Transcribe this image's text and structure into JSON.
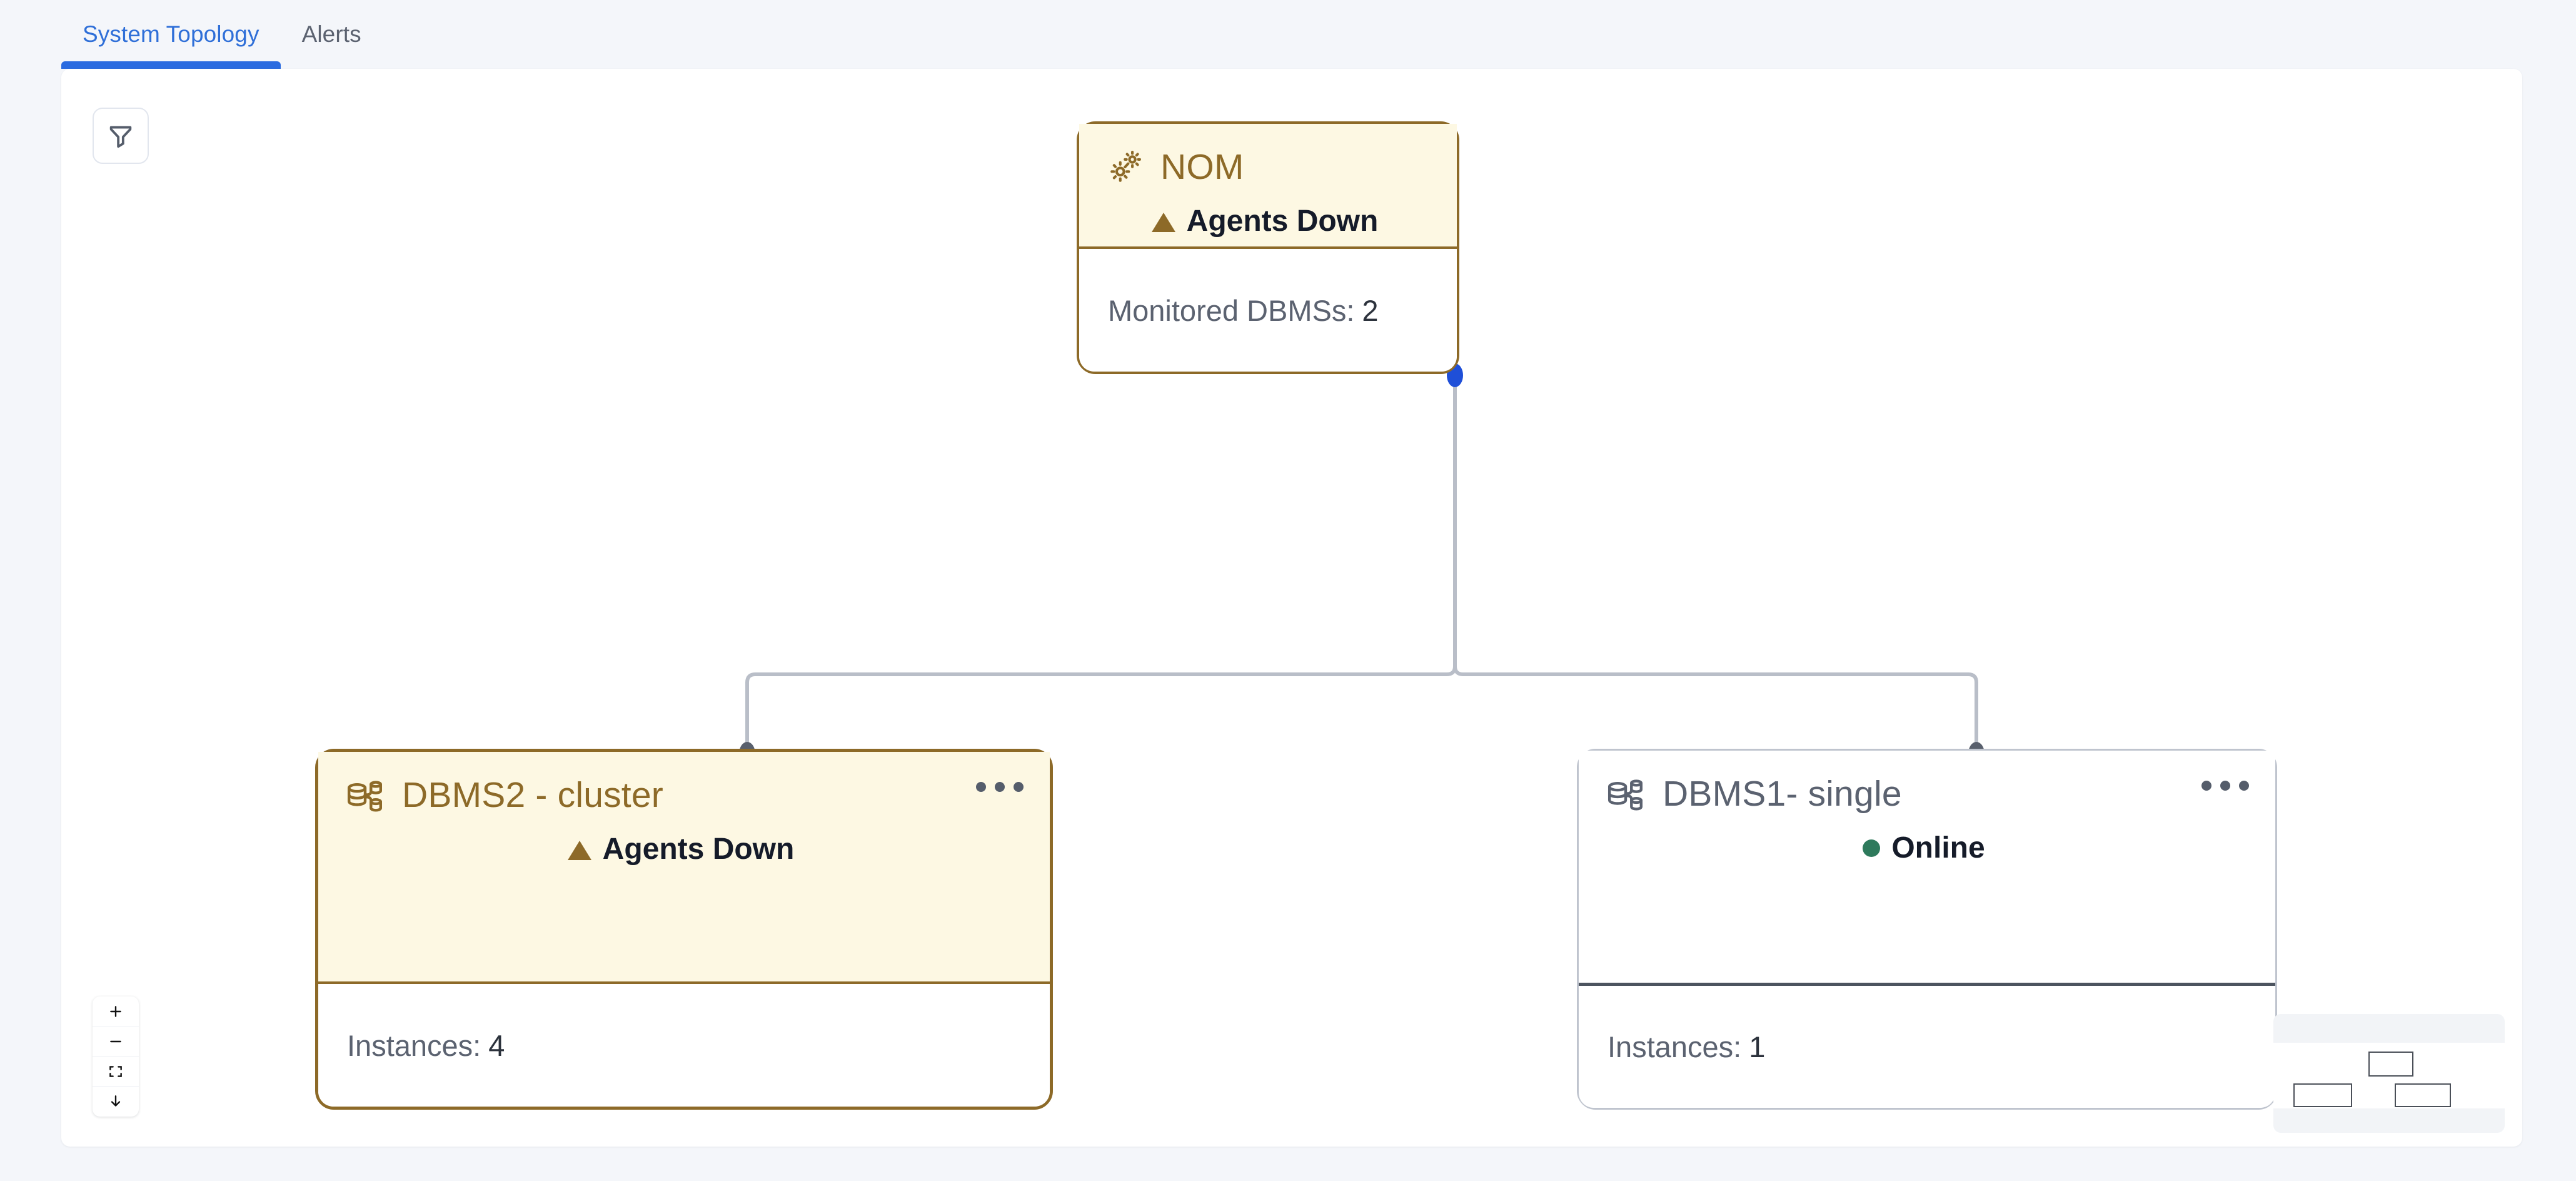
{
  "tabs": [
    {
      "label": "System Topology",
      "active": true
    },
    {
      "label": "Alerts",
      "active": false
    }
  ],
  "toolbar": {
    "filter_icon": "filter-funnel-icon"
  },
  "graph": {
    "nodes": [
      {
        "id": "nom",
        "icon": "gears-icon",
        "title": "NOM",
        "status": "Agents Down",
        "status_kind": "warning",
        "status_icon": "warning-triangle-icon",
        "footer_label": "Monitored DBMSs:",
        "footer_value": "2",
        "has_kebab": false,
        "selected": false
      },
      {
        "id": "dbms2",
        "icon": "database-cluster-icon",
        "title": "DBMS2 - cluster",
        "status": "Agents Down",
        "status_kind": "warning",
        "status_icon": "warning-triangle-icon",
        "footer_label": "Instances:",
        "footer_value": "4",
        "has_kebab": true,
        "kebab_icon": "more-options-icon",
        "selected": true
      },
      {
        "id": "dbms1",
        "icon": "database-cluster-icon",
        "title": "DBMS1- single",
        "status": "Online",
        "status_kind": "online",
        "status_icon": "status-dot-icon",
        "footer_label": "Instances:",
        "footer_value": "1",
        "has_kebab": true,
        "kebab_icon": "more-options-icon",
        "selected": false
      }
    ],
    "edges": [
      {
        "from": "nom",
        "to": "dbms2"
      },
      {
        "from": "nom",
        "to": "dbms1"
      }
    ]
  },
  "zoom_controls": [
    {
      "name": "zoom-in",
      "glyph": "+"
    },
    {
      "name": "zoom-out",
      "glyph": "−"
    },
    {
      "name": "fit-view",
      "glyph": "fit"
    },
    {
      "name": "download",
      "glyph": "↓"
    }
  ],
  "colors": {
    "warning": "#8d6a28",
    "warning_bg": "#fdf8e3",
    "online": "#2e7a5c",
    "accent": "#2a6be0",
    "edge": "#b9bec8",
    "handle_source": "#1f4fd8",
    "handle_target": "#59606d",
    "page_bg": "#f4f6fa"
  }
}
